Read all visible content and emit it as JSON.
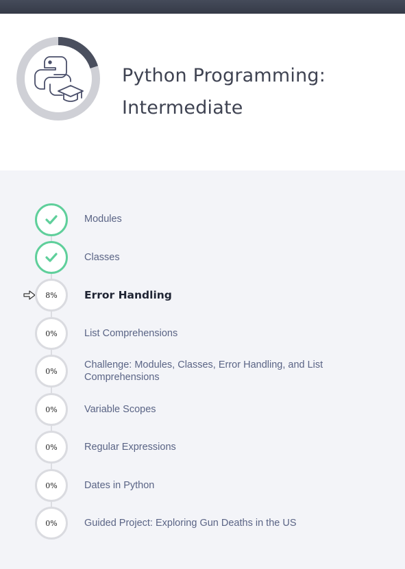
{
  "course": {
    "title_line1": "Python Programming:",
    "title_line2": "Intermediate",
    "progress_fraction": 0.2
  },
  "lessons": [
    {
      "label": "Modules",
      "status": "complete"
    },
    {
      "label": "Classes",
      "status": "complete"
    },
    {
      "label": "Error Handling",
      "status": "current",
      "progress": "8%"
    },
    {
      "label": "List Comprehensions",
      "status": "not-started",
      "progress": "0%"
    },
    {
      "label": "Challenge: Modules, Classes, Error Handling, and List Comprehensions",
      "status": "not-started",
      "progress": "0%"
    },
    {
      "label": "Variable Scopes",
      "status": "not-started",
      "progress": "0%"
    },
    {
      "label": "Regular Expressions",
      "status": "not-started",
      "progress": "0%"
    },
    {
      "label": "Dates in Python",
      "status": "not-started",
      "progress": "0%"
    },
    {
      "label": "Guided Project: Exploring Gun Deaths in the US",
      "status": "not-started",
      "progress": "0%"
    }
  ],
  "colors": {
    "complete": "#5fcf9b",
    "ring_track": "#cfd0d6",
    "ring_fill": "#4a4f5e"
  }
}
